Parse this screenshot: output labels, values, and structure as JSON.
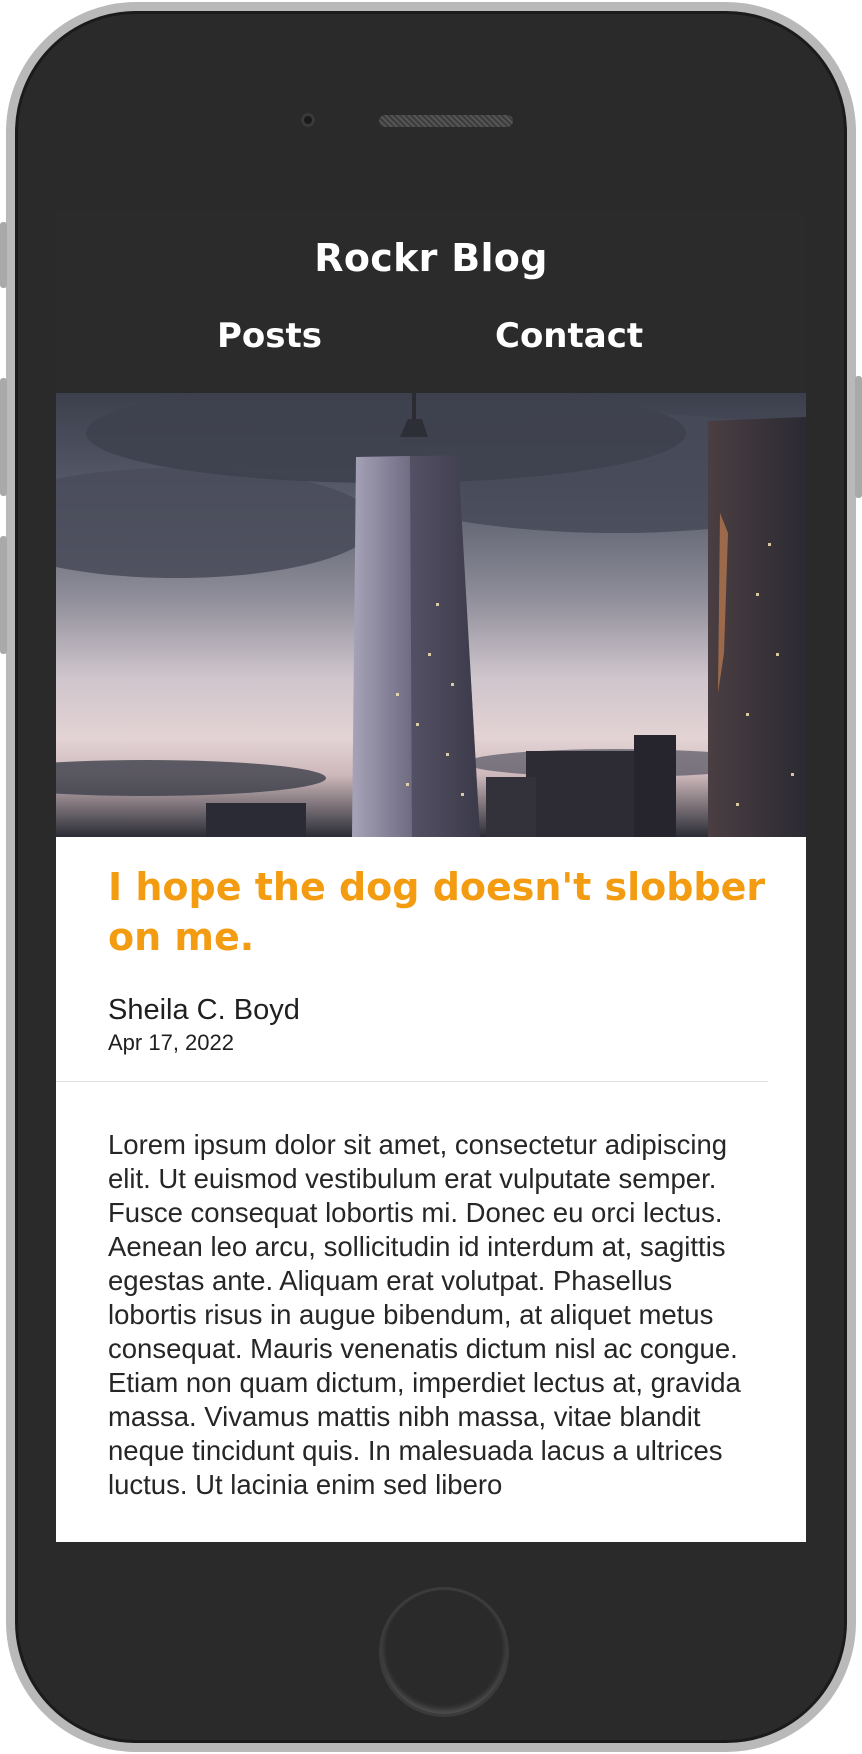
{
  "site": {
    "title": "Rockr Blog",
    "nav": [
      "Posts",
      "Contact"
    ]
  },
  "hero": {
    "image_description_icon": "city-skyline-image"
  },
  "post": {
    "title": "I hope the dog doesn't slobber on me.",
    "author": "Sheila C. Boyd",
    "date": "Apr 17, 2022",
    "body": "Lorem ipsum dolor sit amet, consectetur adipiscing elit. Ut euismod vestibulum erat vulputate semper. Fusce consequat lobortis mi. Donec eu orci lectus. Aenean leo arcu, sollicitudin id interdum at, sagittis egestas ante. Aliquam erat volutpat. Phasellus lobortis risus in augue bibendum, at aliquet metus consequat. Mauris venenatis dictum nisl ac congue. Etiam non quam dictum, imperdiet lectus at, gravida massa. Vivamus mattis nibh massa, vitae blandit neque tincidunt quis. In malesuada lacus a ultrices luctus. Ut lacinia enim sed libero"
  },
  "colors": {
    "header_bg": "#2b2b2b",
    "accent": "#f39c12",
    "phone_body": "#2a2a2a"
  }
}
